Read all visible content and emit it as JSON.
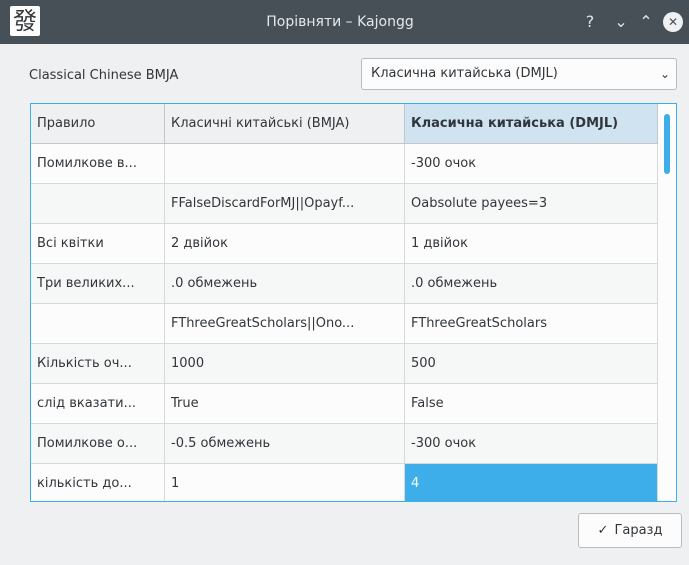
{
  "window": {
    "title": "Порівняти – Kajongg",
    "app_icon_glyph": "發",
    "help_glyph": "?",
    "minimize_glyph": "⌄",
    "maximize_glyph": "⌃",
    "close_glyph": "✕"
  },
  "ruleset_selector": {
    "label": "Classical Chinese BMJA",
    "selected": "Класична китайська (DMJL)"
  },
  "table": {
    "headers": [
      "Правило",
      "Класичні китайські (BMJA)",
      "Класична китайська (DMJL)"
    ],
    "rows": [
      {
        "rule": "Помилкове в...",
        "bmja": "",
        "dmjl": "-300 очок"
      },
      {
        "rule": "",
        "bmja": "FFalseDiscardForMJ||Opayf...",
        "dmjl": "Oabsolute payees=3"
      },
      {
        "rule": "Всі квітки",
        "bmja": "2 двійок",
        "dmjl": "1 двійок"
      },
      {
        "rule": "Три великих...",
        "bmja": ".0 обмежень",
        "dmjl": ".0 обмежень"
      },
      {
        "rule": "",
        "bmja": "FThreeGreatScholars||Ono...",
        "dmjl": "FThreeGreatScholars"
      },
      {
        "rule": "Кількість оч...",
        "bmja": "1000",
        "dmjl": "500"
      },
      {
        "rule": "слід вказати...",
        "bmja": "True",
        "dmjl": "False"
      },
      {
        "rule": "Помилкове о...",
        "bmja": "-0.5 обмежень",
        "dmjl": "-300 очок"
      },
      {
        "rule": "кількість до...",
        "bmja": "1",
        "dmjl": "4"
      }
    ]
  },
  "ok_button": {
    "check_glyph": "✓",
    "label": "Гаразд"
  },
  "colors": {
    "accent": "#3daee9",
    "titlebar": "#475057",
    "window_bg": "#eff0f1"
  }
}
